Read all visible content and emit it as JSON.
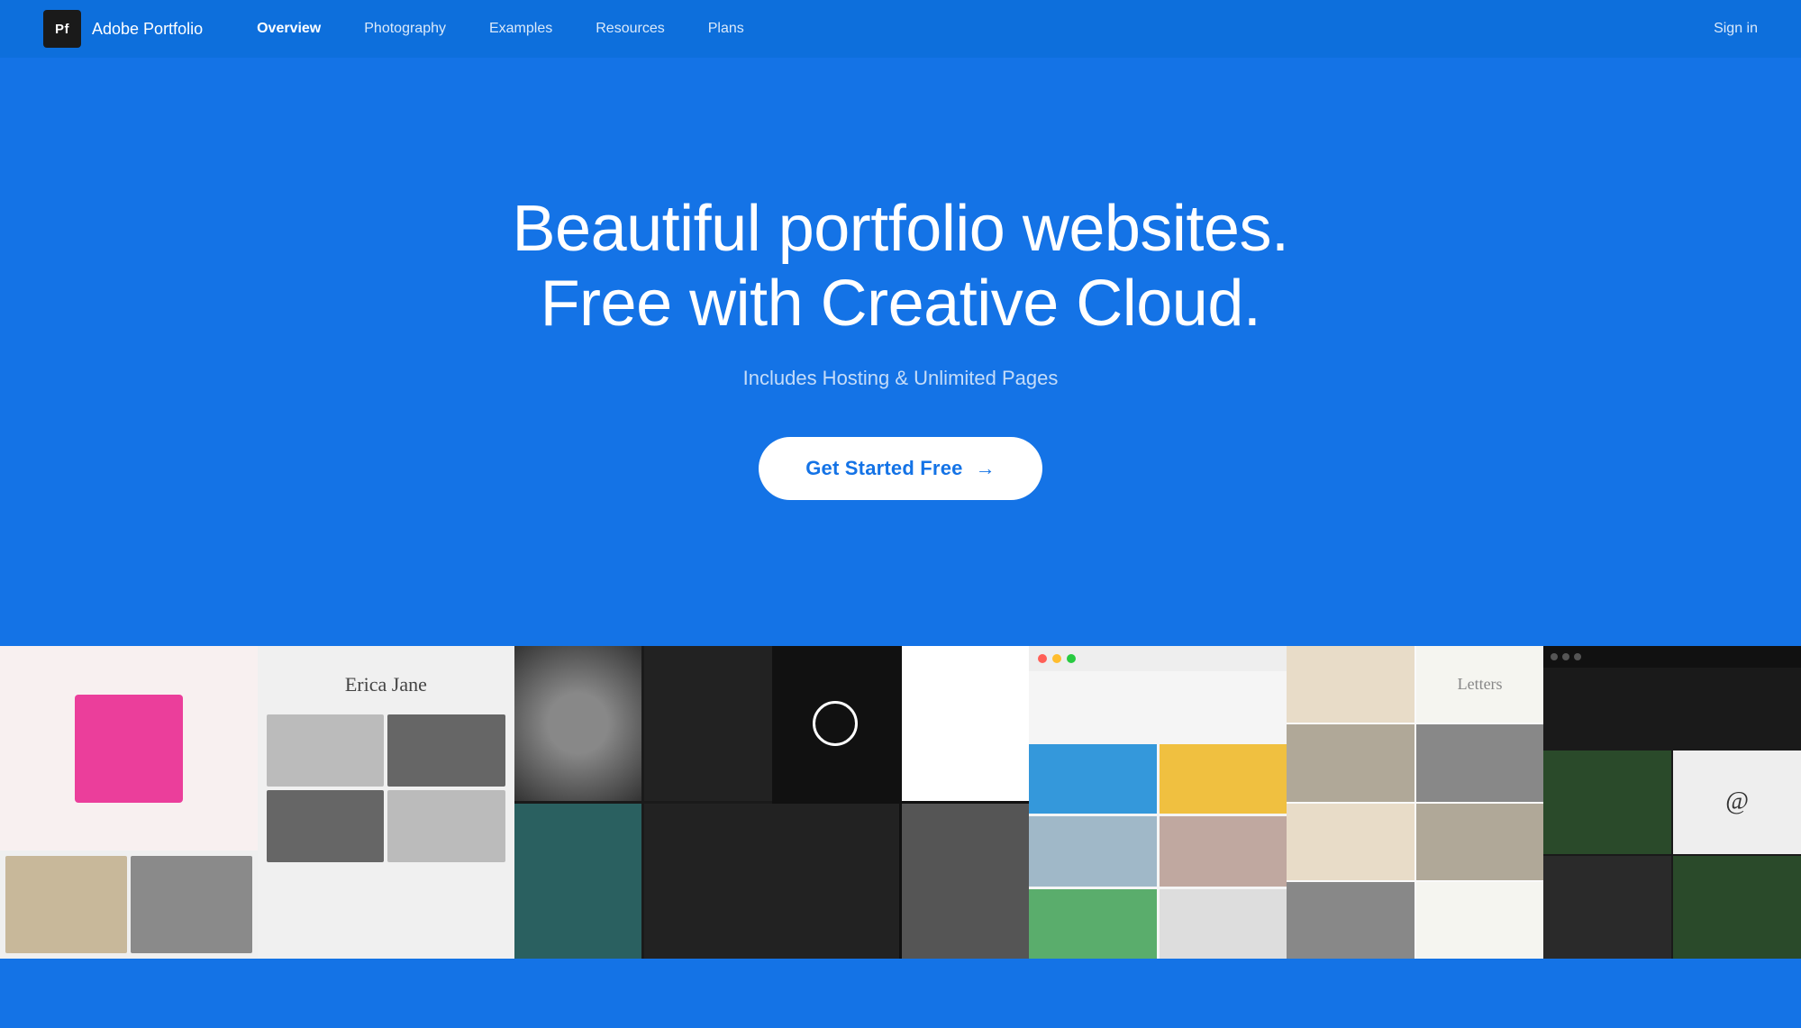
{
  "navbar": {
    "logo_letters": "Pf",
    "brand_name": "Adobe Portfolio",
    "links": [
      {
        "label": "Overview",
        "active": true
      },
      {
        "label": "Photography",
        "active": false
      },
      {
        "label": "Examples",
        "active": false
      },
      {
        "label": "Resources",
        "active": false
      },
      {
        "label": "Plans",
        "active": false
      }
    ],
    "signin_label": "Sign in"
  },
  "hero": {
    "headline_line1": "Beautiful portfolio websites.",
    "headline_line2": "Free with Creative Cloud.",
    "subtext": "Includes Hosting & Unlimited Pages",
    "cta_label": "Get Started Free",
    "cta_arrow": "→"
  },
  "portfolio_previews": {
    "count": 7
  }
}
